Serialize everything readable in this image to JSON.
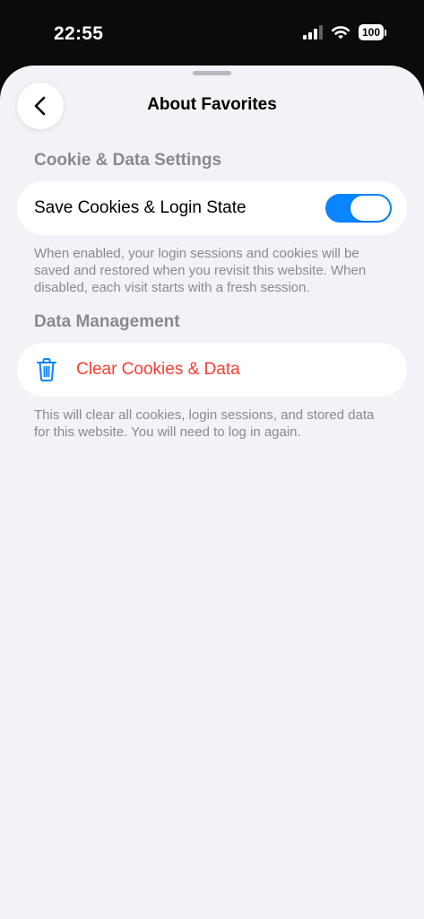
{
  "status_bar": {
    "time": "22:55",
    "battery": "100",
    "icons": [
      "cellular-signal-icon",
      "wifi-icon",
      "battery-icon"
    ]
  },
  "nav": {
    "title": "About Favorites",
    "back_icon": "chevron-left-icon"
  },
  "cookie_section": {
    "header": "Cookie & Data Settings",
    "toggle_label": "Save Cookies & Login State",
    "toggle_on": true,
    "footnote": "When enabled, your login sessions and cookies will be saved and restored when you revisit this website. When disabled, each visit starts with a fresh session."
  },
  "data_section": {
    "header": "Data Management",
    "clear_label": "Clear Cookies & Data",
    "clear_icon": "trash-icon",
    "footnote": "This will clear all cookies, login sessions, and stored data for this website. You will need to log in again."
  },
  "colors": {
    "accent": "#0a84ff",
    "destructive": "#ff3b30",
    "background": "#f2f2f7",
    "secondary_text": "#8a8a8e"
  }
}
